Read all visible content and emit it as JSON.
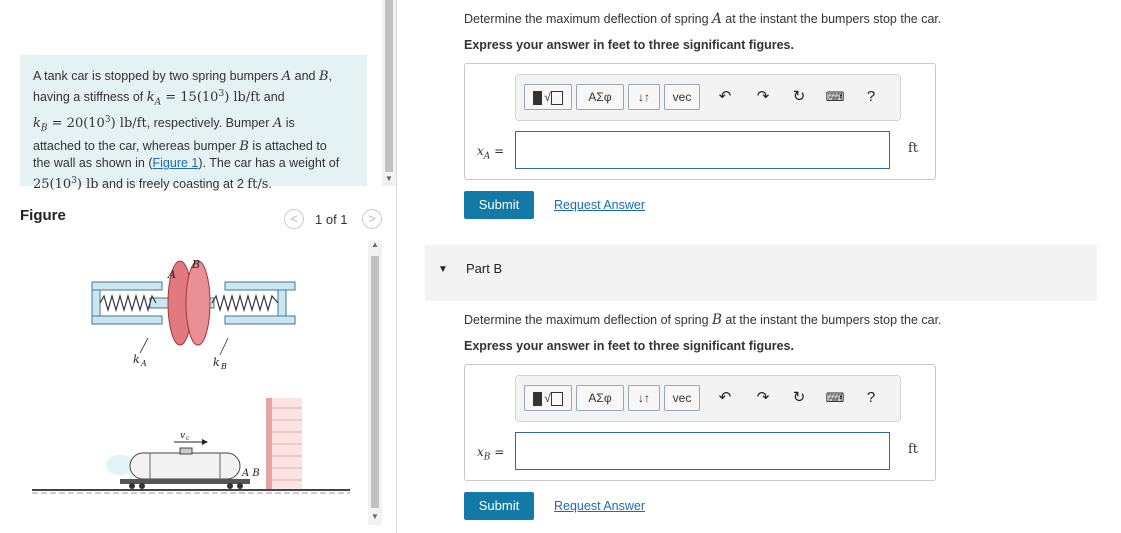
{
  "problem": {
    "line1_a": "A tank car is stopped by two spring bumpers ",
    "A": "A",
    "line1_b": " and ",
    "B": "B",
    "line1_c": ",",
    "line2_a": "having a stiffness of ",
    "kA_eq": "k",
    "kA_sub": "A",
    "kA_val": " = 15(10",
    "kA_exp": "3",
    "kA_unit": ") lb/ft",
    "line2_b": " and",
    "kB_sym": "k",
    "kB_sub": "B",
    "kB_val": " = 20(10",
    "kB_exp": "3",
    "kB_unit": ") lb/ft",
    "line3_b": ", respectively. Bumper ",
    "line3_c": " is",
    "line4_a": "attached to the car, whereas bumper ",
    "line4_b": " is attached to",
    "line5_a": "the wall as shown in (",
    "figure_link": "Figure 1",
    "line5_b": "). The car has a weight of",
    "w_val": "25(10",
    "w_exp": "3",
    "w_unit": ") lb",
    "line6_b": " and is freely coasting at 2 ",
    "speed_unit": "ft/s",
    "line6_c": "."
  },
  "figure": {
    "label": "Figure",
    "pager": "1 of 1",
    "prev": "<",
    "next": ">",
    "diagram_labels": {
      "A": "A",
      "B": "B",
      "kA": "k",
      "kA_sub": "A",
      "kB": "k",
      "kB_sub": "B",
      "vc": "v",
      "vc_sub": "c",
      "AB": "A B"
    }
  },
  "partA": {
    "question_a": "Determine the maximum deflection of spring ",
    "question_var": "A",
    "question_b": " at the instant the bumpers stop the car.",
    "instruction": "Express your answer in feet to three significant figures.",
    "var_sym": "x",
    "var_sub": "A",
    "var_eq": " =",
    "unit": "ft",
    "input_value": "",
    "submit": "Submit",
    "request": "Request Answer"
  },
  "partB": {
    "header": "Part B",
    "question_a": "Determine the maximum deflection of spring ",
    "question_var": "B",
    "question_b": " at the instant the bumpers stop the car.",
    "instruction": "Express your answer in feet to three significant figures.",
    "var_sym": "x",
    "var_sub": "B",
    "var_eq": " =",
    "unit": "ft",
    "input_value": "",
    "submit": "Submit",
    "request": "Request Answer"
  },
  "toolbar": {
    "templates": "√",
    "greek": "ΑΣφ",
    "arrows": "↓↑",
    "vec": "vec",
    "undo": "undo-icon",
    "redo": "redo-icon",
    "reset": "reset-icon",
    "keyboard": "keyboard-icon",
    "help": "?"
  },
  "colors": {
    "accent": "#137aa8",
    "link": "#1a6bb5",
    "problem_bg": "#e4f2f4"
  }
}
